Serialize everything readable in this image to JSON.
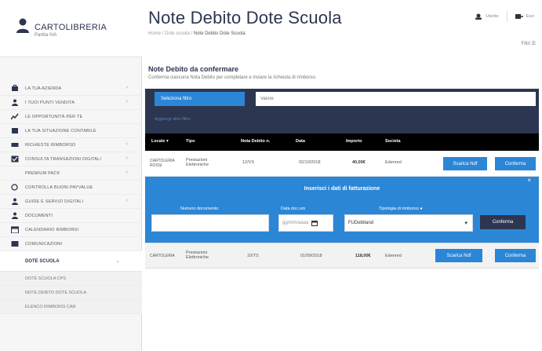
{
  "brand": {
    "name": "CARTOLIBRERIA",
    "sub": "Partita IVA"
  },
  "sidebar": {
    "items": [
      {
        "label": "LA TUA AZIENDA",
        "icon": "briefcase-icon",
        "arrow": "›"
      },
      {
        "label": "I TUOI PUNTI VENDITA",
        "icon": "person-icon",
        "arrow": "›"
      },
      {
        "label": "LE OPPORTUNITÀ PER TE",
        "icon": "chart-icon",
        "arrow": ""
      },
      {
        "label": "LA TUA SITUAZIONE CONTABILE",
        "icon": "ledger-icon",
        "arrow": ""
      },
      {
        "label": "RICHIESTE RIMBORSO",
        "icon": "money-icon",
        "arrow": "›"
      },
      {
        "label": "CONSULTA TRANSAZIONI DIGITALI",
        "icon": "check-icon",
        "arrow": "›"
      },
      {
        "label": "PREMIUM PACK",
        "icon": "",
        "arrow": "›"
      },
      {
        "label": "CONTROLLA BUONI PAYVALUE",
        "icon": "search-icon",
        "arrow": ""
      },
      {
        "label": "GUIDE E SERVIZI DIGITALI",
        "icon": "person-icon",
        "arrow": "›"
      },
      {
        "label": "DOCUMENTI",
        "icon": "person-icon",
        "arrow": ""
      },
      {
        "label": "CALENDARIO RIMBORSI",
        "icon": "calendar-icon",
        "arrow": ""
      },
      {
        "label": "COMUNICAZIONI",
        "icon": "message-icon",
        "arrow": ""
      }
    ],
    "section": {
      "label": "DOTE SCUOLA",
      "arrow": "⌄"
    },
    "subitems": [
      "DOTE SCUOLA CPS",
      "NOTE DEBITO DOTE SCUOLA",
      "ELENCO RIMBORSI CAR"
    ]
  },
  "header": {
    "title": "Note Debito Dote Scuola",
    "breadcrumb": [
      "Home",
      "Dote scuola",
      "Note Debito Dote Scuola"
    ],
    "top_links": [
      "Utente",
      "Esci"
    ],
    "right_link": "Filtri"
  },
  "section": {
    "title": "Note Debito da confermare",
    "description": "Conferma ciascuna Nota Debito per completare e inviare la richiesta di rimborso."
  },
  "filter": {
    "button": "Seleziona filtro",
    "placeholder": "Valore",
    "link": "Aggiungi altro filtro"
  },
  "table": {
    "headers": [
      "Locale",
      "Tipo",
      "Nota Debito n.",
      "Data",
      "Importo",
      "Societa"
    ],
    "sort_indicator": "▾",
    "rows": [
      {
        "locale": "CARTOLERIA ROSSI",
        "tipo": "Prestazioni Elettroniche",
        "nota": "12/VS",
        "data": "02/10/2018",
        "importo": "40,00€",
        "societa": "Edenred",
        "btn_scarica": "Scarica Ndf",
        "btn_conferma": "Conferma"
      },
      {
        "locale": "CARTOLERIA",
        "tipo": "Prestazioni Elettroniche",
        "nota": "10/TS",
        "data": "01/09/2018",
        "importo": "118,00€",
        "societa": "Edenred",
        "btn_scarica": "Scarica Ndf",
        "btn_conferma": "Conferma"
      }
    ]
  },
  "form": {
    "title": "Inserisci i dati di fatturazione",
    "close": "×",
    "fields": {
      "numero_label": "Numero documento",
      "numero_value": "",
      "data_label": "Data doc.um",
      "data_placeholder": "gg/mm/aaaa",
      "tipologia_label": "Tipologia di rimborso",
      "tipologia_value": "FUDebitand"
    },
    "button": "Conferma"
  }
}
